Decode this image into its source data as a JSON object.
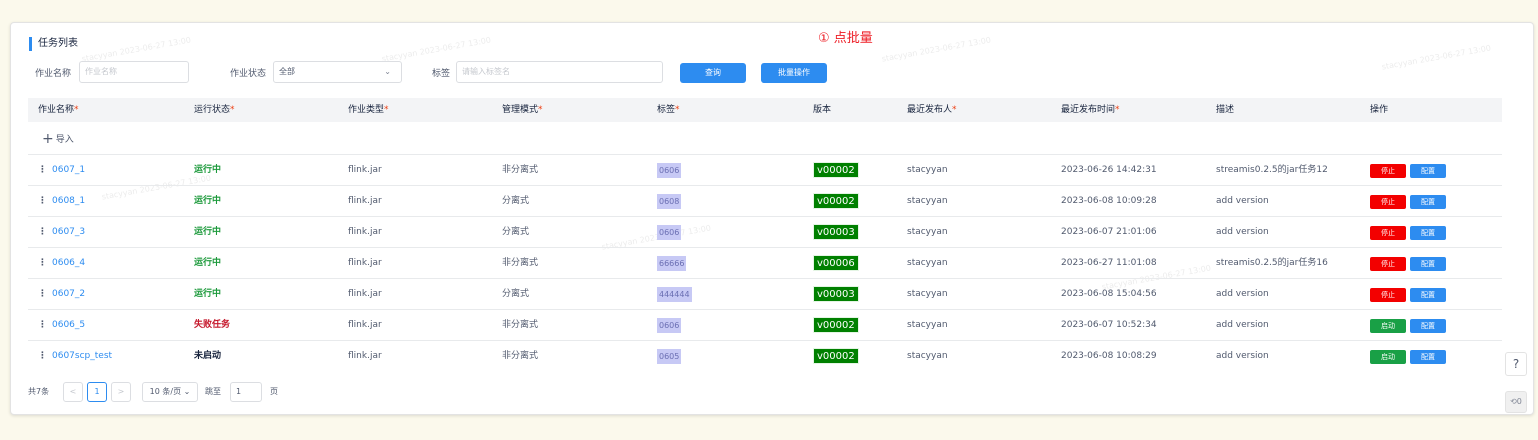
{
  "page": {
    "title": "任务列表"
  },
  "filters": {
    "job_name_label": "作业名称",
    "job_name_placeholder": "作业名称",
    "job_status_label": "作业状态",
    "job_status_value": "全部",
    "tag_label": "标签",
    "tag_placeholder": "请输入标签名",
    "query_button": "查询",
    "batch_button": "批量操作"
  },
  "annotation": "① 点批量",
  "table": {
    "columns": [
      {
        "label": "作业名称",
        "required": true
      },
      {
        "label": "运行状态",
        "required": true
      },
      {
        "label": "作业类型",
        "required": true
      },
      {
        "label": "管理模式",
        "required": true
      },
      {
        "label": "标签",
        "required": true
      },
      {
        "label": "版本",
        "required": false
      },
      {
        "label": "最近发布人",
        "required": true
      },
      {
        "label": "最近发布时间",
        "required": true
      },
      {
        "label": "描述",
        "required": false
      },
      {
        "label": "操作",
        "required": false
      }
    ],
    "required_mark": "*",
    "import_label": "导入",
    "rows": [
      {
        "name": "0607_1",
        "status": "运行中",
        "status_kind": "running",
        "type": "flink.jar",
        "mode": "非分离式",
        "tag": "0606",
        "version": "v00002",
        "publisher": "stacyyan",
        "time": "2023-06-26 14:42:31",
        "desc": "streamis0.2.5的jar任务12",
        "action": "停止",
        "action_kind": "stop",
        "config": "配置"
      },
      {
        "name": "0608_1",
        "status": "运行中",
        "status_kind": "running",
        "type": "flink.jar",
        "mode": "分离式",
        "tag": "0608",
        "version": "v00002",
        "publisher": "stacyyan",
        "time": "2023-06-08 10:09:28",
        "desc": "add version",
        "action": "停止",
        "action_kind": "stop",
        "config": "配置"
      },
      {
        "name": "0607_3",
        "status": "运行中",
        "status_kind": "running",
        "type": "flink.jar",
        "mode": "分离式",
        "tag": "0606",
        "version": "v00003",
        "publisher": "stacyyan",
        "time": "2023-06-07 21:01:06",
        "desc": "add version",
        "action": "停止",
        "action_kind": "stop",
        "config": "配置"
      },
      {
        "name": "0606_4",
        "status": "运行中",
        "status_kind": "running",
        "type": "flink.jar",
        "mode": "非分离式",
        "tag": "66666",
        "version": "v00006",
        "publisher": "stacyyan",
        "time": "2023-06-27 11:01:08",
        "desc": "streamis0.2.5的jar任务16",
        "action": "停止",
        "action_kind": "stop",
        "config": "配置"
      },
      {
        "name": "0607_2",
        "status": "运行中",
        "status_kind": "running",
        "type": "flink.jar",
        "mode": "分离式",
        "tag": "444444",
        "version": "v00003",
        "publisher": "stacyyan",
        "time": "2023-06-08 15:04:56",
        "desc": "add version",
        "action": "停止",
        "action_kind": "stop",
        "config": "配置"
      },
      {
        "name": "0606_5",
        "status": "失败任务",
        "status_kind": "failed",
        "type": "flink.jar",
        "mode": "非分离式",
        "tag": "0606",
        "version": "v00002",
        "publisher": "stacyyan",
        "time": "2023-06-07 10:52:34",
        "desc": "add version",
        "action": "启动",
        "action_kind": "start",
        "config": "配置"
      },
      {
        "name": "0607scp_test",
        "status": "未启动",
        "status_kind": "stopped",
        "type": "flink.jar",
        "mode": "非分离式",
        "tag": "0605",
        "version": "v00002",
        "publisher": "stacyyan",
        "time": "2023-06-08 10:08:29",
        "desc": "add version",
        "action": "启动",
        "action_kind": "start",
        "config": "配置"
      }
    ]
  },
  "pagination": {
    "total": "共7条",
    "prev": "<",
    "current": "1",
    "next": ">",
    "page_size": "10 条/页",
    "goto_label": "跳至",
    "goto_value": "1",
    "page_unit": "页"
  },
  "side": {
    "help": "?",
    "other": "⟲0"
  },
  "colors": {
    "primary": "#2d8cf0",
    "stop": "#f30000",
    "start": "#19a046",
    "version": "#008000",
    "tag": "#c7c9f5",
    "annotation": "#ed1c24"
  }
}
